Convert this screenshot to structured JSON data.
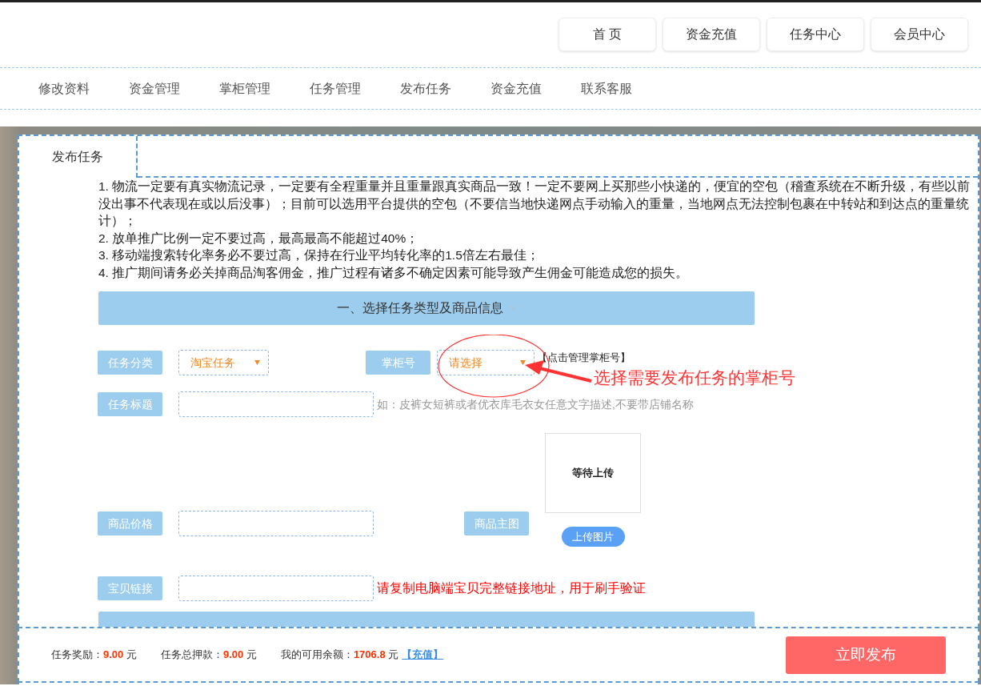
{
  "header_nav": [
    {
      "label": "首 页"
    },
    {
      "label": "资金充值"
    },
    {
      "label": "任务中心"
    },
    {
      "label": "会员中心"
    }
  ],
  "sub_nav": [
    {
      "label": "修改资料"
    },
    {
      "label": "资金管理"
    },
    {
      "label": "掌柜管理"
    },
    {
      "label": "任务管理"
    },
    {
      "label": "发布任务"
    },
    {
      "label": "资金充值"
    },
    {
      "label": "联系客服"
    }
  ],
  "tabs": [
    {
      "label": "发布任务",
      "selected": true
    }
  ],
  "notices": [
    "1. 物流一定要有真实物流记录，一定要有全程重量并且重量跟真实商品一致！一定不要网上买那些小快递的，便宜的空包（稽查系统在不断升级，有些以前没出事不代表现在或以后没事）；目前可以选用平台提供的空包（不要信当地快递网点手动输入的重量，当地网点无法控制包裹在中转站和到达点的重量统计）；",
    "2. 放单推广比例一定不要过高，最高最高不能超过40%；",
    "3. 移动端搜索转化率务必不要过高，保持在行业平均转化率的1.5倍左右最佳；",
    "4. 推广期间请务必关掉商品淘客佣金，推广过程有诸多不确定因素可能导致产生佣金可能造成您的损失。"
  ],
  "section": {
    "title": "一、选择任务类型及商品信息",
    "expanded": true
  },
  "form": {
    "category": {
      "label": "任务分类",
      "value": "淘宝任务"
    },
    "shopkeeper": {
      "label": "掌柜号",
      "value": "请选择",
      "link": "【点击管理掌柜号】"
    },
    "title": {
      "label": "任务标题",
      "hint": "如：皮裤女短裤或者优衣库毛衣女任意文字描述,不要带店铺名称"
    },
    "price": {
      "label": "商品价格"
    },
    "image": {
      "label": "商品主图",
      "preview": "等待上传",
      "button": "上传图片"
    },
    "link": {
      "label": "宝贝链接",
      "hint": "请复制电脑端宝贝完整链接地址，用于刷手验证"
    }
  },
  "annotation": {
    "text": "选择需要发布任务的掌柜号"
  },
  "footer": {
    "items": [
      {
        "label": "任务奖励：",
        "amount": "9.00",
        "unit": "元"
      },
      {
        "label": "任务总押款：",
        "amount": "9.00",
        "unit": "元"
      },
      {
        "label": "我的可用余额：",
        "amount": "1706.8",
        "unit": "元"
      }
    ],
    "recharge": "【充值】",
    "submit": "立即发布"
  }
}
